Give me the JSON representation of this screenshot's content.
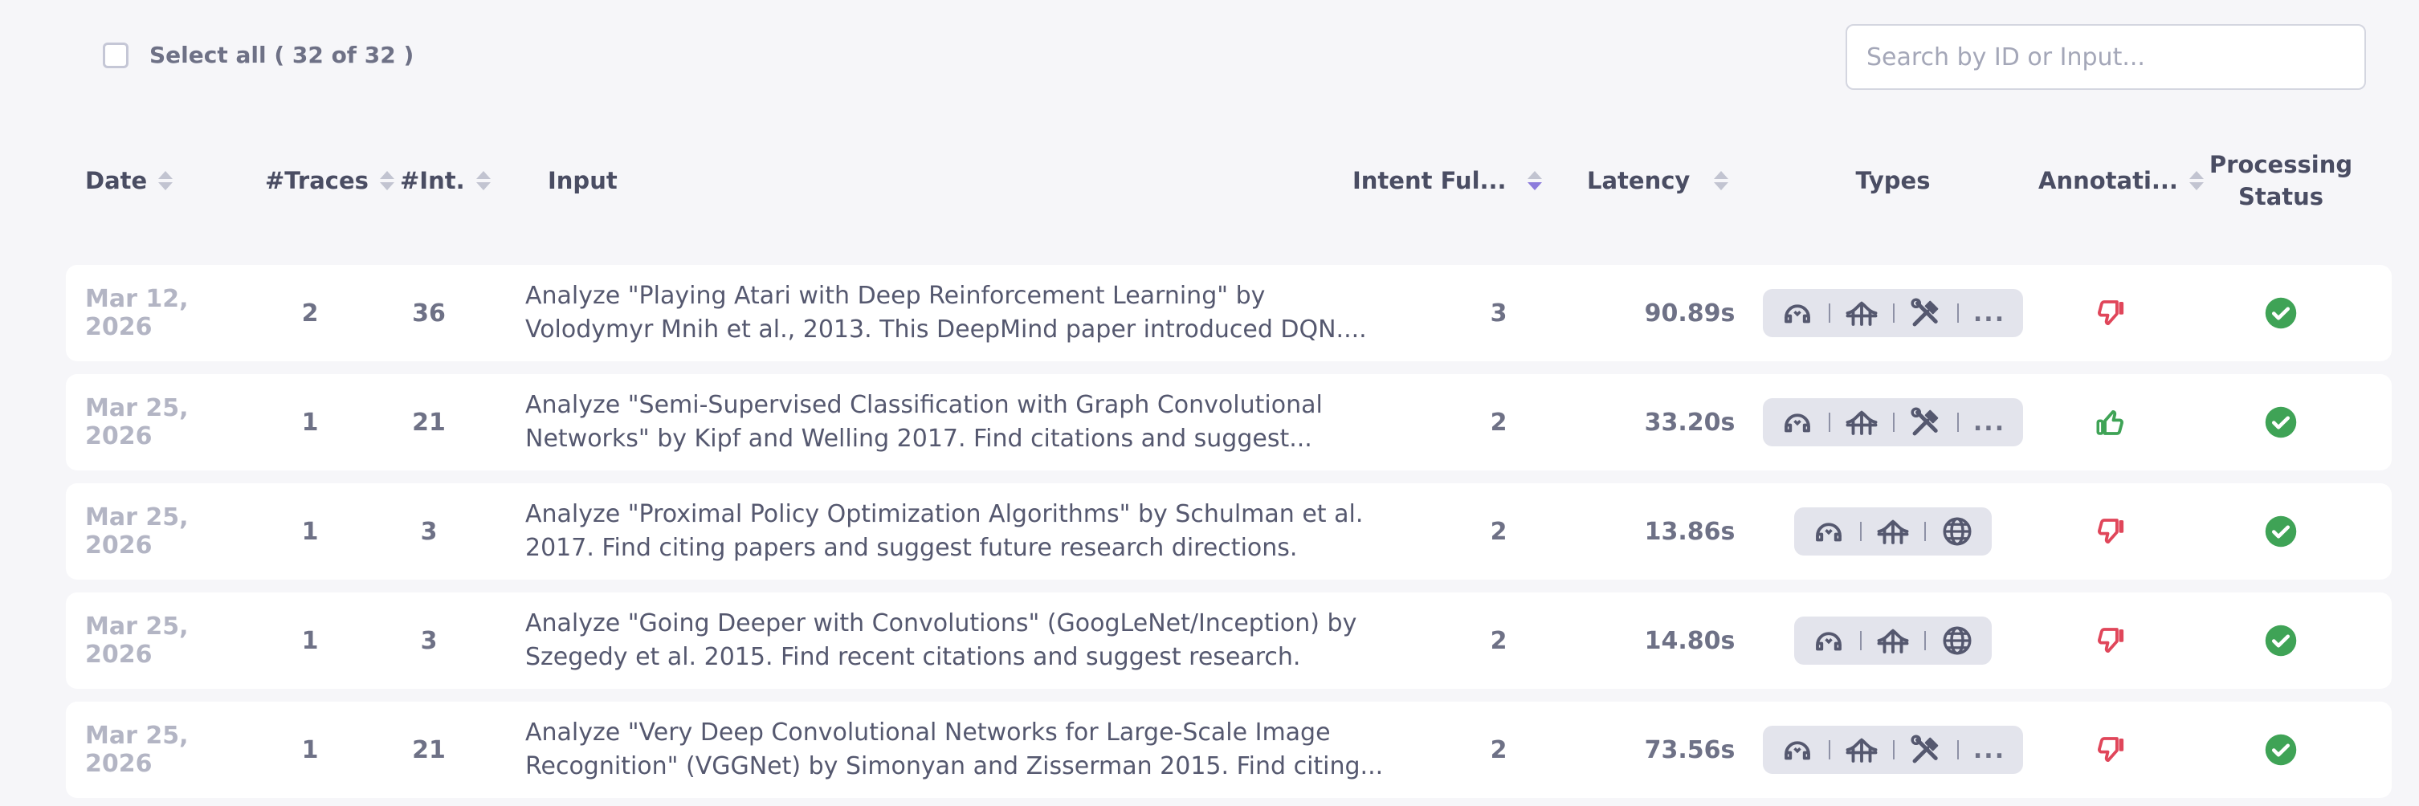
{
  "toolbar": {
    "select_all_label": "Select all ( 32 of 32 )",
    "search_placeholder": "Search by ID or Input..."
  },
  "columns": {
    "date": "Date",
    "traces": "#Traces",
    "interactions": "#Int.",
    "input": "Input",
    "intent": "Intent Ful...",
    "latency": "Latency",
    "types": "Types",
    "annotation": "Annotati...",
    "processing_line1": "Processing",
    "processing_line2": "Status"
  },
  "colors": {
    "thumbs_down": "#e0465a",
    "thumbs_up": "#3fa356",
    "status_ok": "#3fa356",
    "sort_active": "#8c7bdc"
  },
  "rows": [
    {
      "date": "Mar 12, 2026",
      "traces": "2",
      "interactions": "36",
      "input": "Analyze \"Playing Atari with Deep Reinforcement Learning\" by Volodymyr Mnih et al., 2013. This DeepMind paper introduced DQN....",
      "intent": "3",
      "latency": "90.89s",
      "types": [
        "agent-icon",
        "bridge-icon",
        "tools-icon"
      ],
      "types_more": "...",
      "annotation": "thumbs-down",
      "status": "complete"
    },
    {
      "date": "Mar 25, 2026",
      "traces": "1",
      "interactions": "21",
      "input": "Analyze \"Semi-Supervised Classification with Graph Convolutional Networks\" by Kipf and Welling 2017. Find citations and suggest...",
      "intent": "2",
      "latency": "33.20s",
      "types": [
        "agent-icon",
        "bridge-icon",
        "tools-icon"
      ],
      "types_more": "...",
      "annotation": "thumbs-up",
      "status": "complete"
    },
    {
      "date": "Mar 25, 2026",
      "traces": "1",
      "interactions": "3",
      "input": "Analyze \"Proximal Policy Optimization Algorithms\" by Schulman et al. 2017. Find citing papers and suggest future research directions.",
      "intent": "2",
      "latency": "13.86s",
      "types": [
        "agent-icon",
        "bridge-icon",
        "globe-icon"
      ],
      "types_more": "",
      "annotation": "thumbs-down",
      "status": "complete"
    },
    {
      "date": "Mar 25, 2026",
      "traces": "1",
      "interactions": "3",
      "input": "Analyze \"Going Deeper with Convolutions\" (GoogLeNet/Inception) by Szegedy et al. 2015. Find recent citations and suggest research.",
      "intent": "2",
      "latency": "14.80s",
      "types": [
        "agent-icon",
        "bridge-icon",
        "globe-icon"
      ],
      "types_more": "",
      "annotation": "thumbs-down",
      "status": "complete"
    },
    {
      "date": "Mar 25, 2026",
      "traces": "1",
      "interactions": "21",
      "input": "Analyze \"Very Deep Convolutional Networks for Large-Scale Image Recognition\" (VGGNet) by Simonyan and Zisserman 2015. Find citing...",
      "intent": "2",
      "latency": "73.56s",
      "types": [
        "agent-icon",
        "bridge-icon",
        "tools-icon"
      ],
      "types_more": "...",
      "annotation": "thumbs-down",
      "status": "complete"
    }
  ]
}
